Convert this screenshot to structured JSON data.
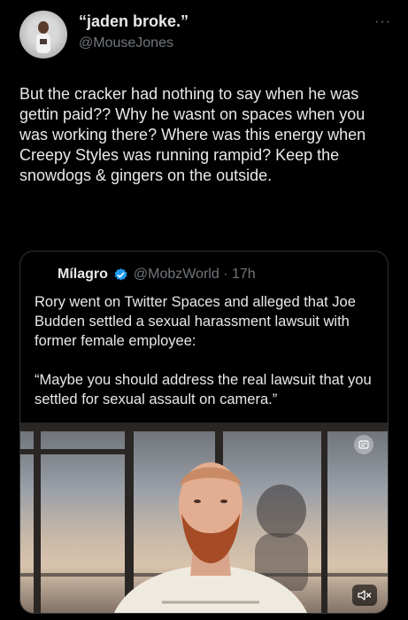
{
  "tweet": {
    "display_name": "“jaden broke.”",
    "handle": "@MouseJones",
    "more_icon": "more-icon",
    "text": "But the cracker had nothing to say when he was gettin paid?? Why he wasnt on spaces when you was working there? Where was this energy when Creepy Styles was running rampid? Keep the snowdogs & gingers on the outside."
  },
  "quoted": {
    "display_name": "Mílagro",
    "handle_time": "@MobzWorld · 17h",
    "paragraph1": "Rory went on Twitter Spaces and alleged that Joe Budden settled a sexual harassment lawsuit with former female employee:",
    "paragraph2": "“Maybe you should address the real lawsuit that you settled for sexual assault on camera.”",
    "media": {
      "badge_icon": "gif-badge-icon",
      "mute_icon": "mute-icon"
    }
  },
  "colors": {
    "background": "#000000",
    "text_primary": "#e7e9ea",
    "text_secondary": "#71767b",
    "border": "#2f3336",
    "verified": "#1d9bf0"
  }
}
